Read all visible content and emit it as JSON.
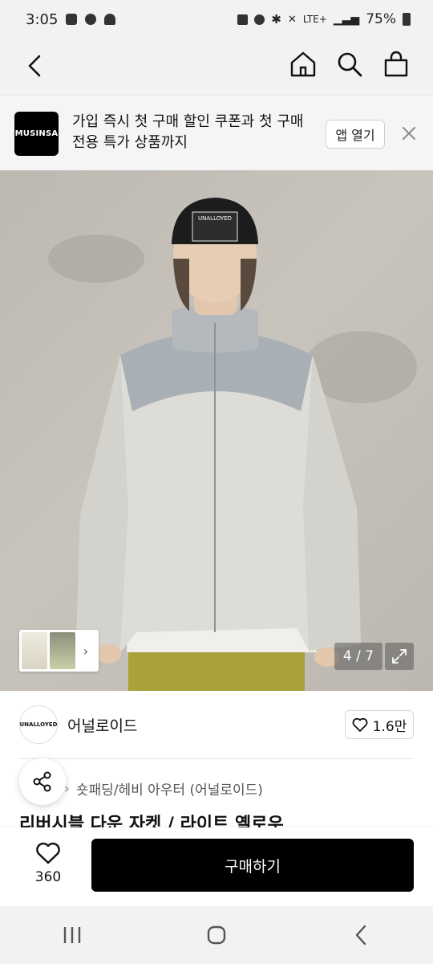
{
  "status_bar": {
    "time": "3:05",
    "network": "LTE+",
    "battery": "75%"
  },
  "nav": {
    "back_icon": "chevron-left-icon",
    "home_icon": "home-icon",
    "search_icon": "search-icon",
    "cart_icon": "shopping-bag-icon"
  },
  "banner": {
    "logo_text": "MUSINSA",
    "message": "가입 즉시 첫 구매 할인 쿠폰과 첫 구매 전용 특가 상품까지",
    "open_label": "앱 열기",
    "close_icon": "close-icon"
  },
  "gallery": {
    "counter": "4 / 7",
    "cap_text": "UNALLOYED",
    "thumb_arrow": "›"
  },
  "brand": {
    "logo_text": "UNALLOYED",
    "name": "어널로이드",
    "like_count": "1.6만"
  },
  "breadcrumb": {
    "category": "숏패딩/헤비 아우터 (어널로이드)"
  },
  "product": {
    "title": "리버시블 다운 자켓 / 라이트 옐로우"
  },
  "purchase": {
    "wish_count": "360",
    "buy_label": "구매하기"
  },
  "colors": {
    "primary": "#000000",
    "background": "#ffffff",
    "bar": "#f2f2f2"
  }
}
